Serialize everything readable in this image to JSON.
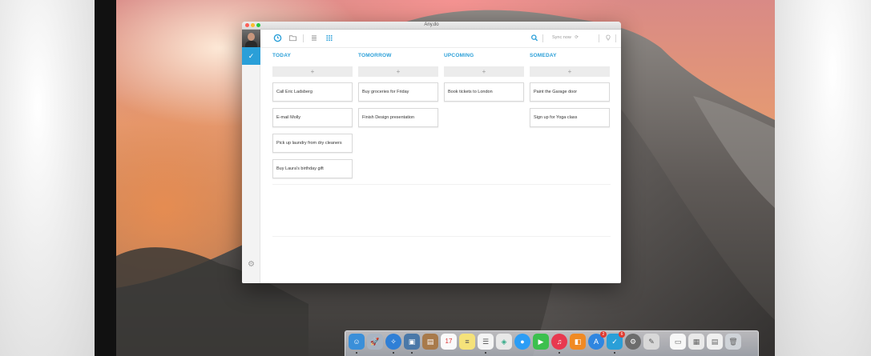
{
  "window": {
    "title": "Any.do"
  },
  "toolbar": {
    "sync_label": "Sync now",
    "sync_icon": "⟳",
    "icons": [
      "clock-icon",
      "folder-icon",
      "list-icon",
      "grid-icon",
      "search-icon",
      "sync-icon",
      "lightbulb-icon",
      "circle-icon"
    ]
  },
  "colors": {
    "accent": "#2a9fd8"
  },
  "add_label": "+",
  "columns": [
    {
      "title": "TODAY",
      "tasks": [
        "Call Eric Ladsberg",
        "E-mail Molly",
        "Pick up laundry from dry cleaners",
        "Buy Laura's birthday gift"
      ]
    },
    {
      "title": "TOMORROW",
      "tasks": [
        "Buy groceries for Friday",
        "Finish Design presentation"
      ]
    },
    {
      "title": "UPCOMING",
      "tasks": [
        "Book tickets to London"
      ]
    },
    {
      "title": "SOMEDAY",
      "tasks": [
        "Paint the Garage door",
        "Sign up for Yoga class"
      ]
    }
  ],
  "sidebar": {
    "check_icon": "✓",
    "gear_icon": "⚙"
  },
  "dock": {
    "calendar_day": "17",
    "app_store_badge": "2",
    "anydo_badge": "6"
  }
}
